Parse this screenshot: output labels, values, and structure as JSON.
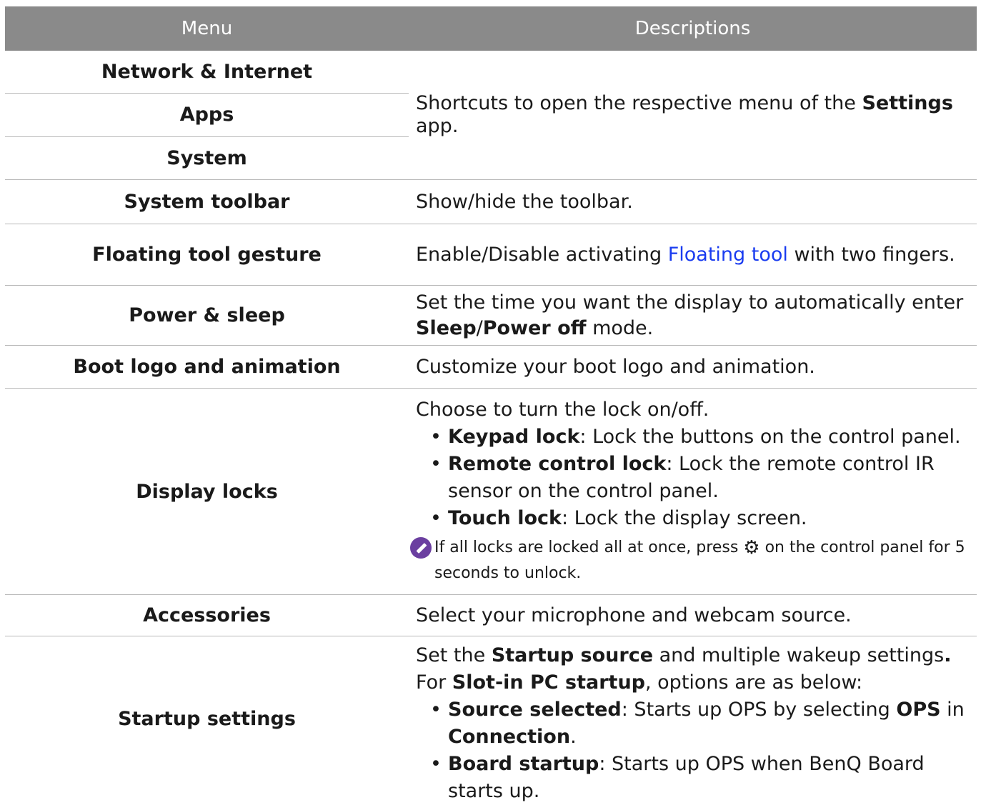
{
  "header": {
    "menu": "Menu",
    "descriptions": "Descriptions"
  },
  "shortcuts": {
    "items": [
      "Network & Internet",
      "Apps",
      "System"
    ],
    "desc_pre": "Shortcuts to open the respective menu of the ",
    "desc_bold": "Settings",
    "desc_post": " app."
  },
  "rows": {
    "system_toolbar": {
      "menu": "System toolbar",
      "desc": "Show/hide the toolbar."
    },
    "floating_tool": {
      "menu": "Floating tool gesture",
      "desc_pre": "Enable/Disable activating ",
      "link": "Floating tool",
      "desc_post": " with two fingers."
    },
    "power_sleep": {
      "menu": "Power & sleep",
      "desc_pre": "Set the time you want the display to automatically enter ",
      "bold1": "Sleep",
      "slash": "/",
      "bold2": "Power off",
      "desc_post": " mode."
    },
    "boot_logo": {
      "menu": "Boot logo and animation",
      "desc": "Customize your boot logo and animation."
    },
    "display_locks": {
      "menu": "Display locks",
      "intro": "Choose to turn the lock on/off.",
      "bullet_char": "•",
      "bullets": [
        {
          "bold": "Keypad lock",
          "text": ": Lock the buttons on the control panel."
        },
        {
          "bold": "Remote control lock",
          "text": ": Lock the remote control IR sensor on the control panel."
        },
        {
          "bold": "Touch lock",
          "text": ": Lock the display screen."
        }
      ],
      "note_pre": "If all locks are locked all at once, press ",
      "note_icon": "gear-icon",
      "note_glyph": "⚙",
      "note_post": " on the control panel for 5 seconds to unlock."
    },
    "accessories": {
      "menu": "Accessories",
      "desc": "Select your microphone and webcam source."
    },
    "startup": {
      "menu": "Startup settings",
      "line1_pre": "Set the ",
      "line1_bold": "Startup source",
      "line1_post": " and multiple wakeup settings",
      "line1_end": ".",
      "line2_pre": "For ",
      "line2_bold": "Slot-in PC startup",
      "line2_post": ", options are as below:",
      "bullets": [
        {
          "bold": "Source selected",
          "text1": ": Starts up OPS by selecting ",
          "bold2": "OPS",
          "text2": " in ",
          "bold3": "Connection",
          "text3": "."
        },
        {
          "bold": "Board startup",
          "text1": ": Starts up OPS when BenQ Board starts up."
        }
      ]
    }
  }
}
